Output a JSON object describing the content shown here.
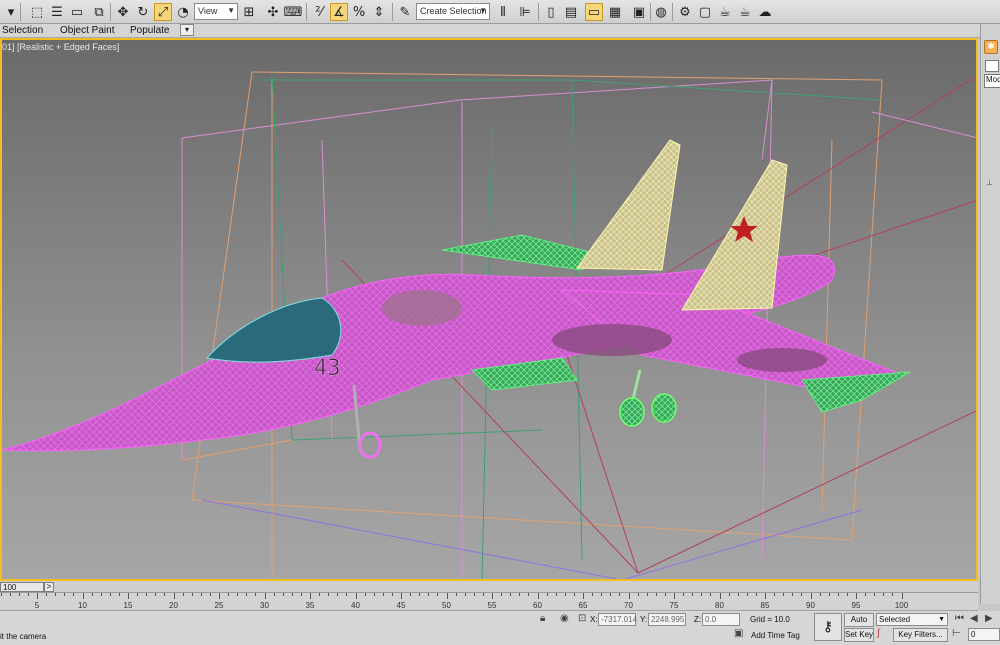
{
  "toolbar": {
    "view_dropdown": "View",
    "selection_set_placeholder": "Create Selection Se",
    "icons": [
      "undo-icon",
      "select-object-icon",
      "select-by-name-icon",
      "rectangular-region-icon",
      "window-crossing-icon",
      "select-move-icon",
      "select-rotate-icon",
      "select-scale-icon",
      "select-place-icon",
      "reference-coordinate-dropdown",
      "use-pivot-icon",
      "select-manipulate-icon",
      "keyboard-shortcut-icon",
      "snaps-toggle-icon",
      "angle-snap-icon",
      "percent-snap-icon",
      "spinner-snap-icon",
      "edit-named-selection-icon",
      "mirror-icon",
      "align-icon",
      "toggle-scene-explorer-icon",
      "toggle-layer-explorer-icon",
      "toggle-ribbon-icon",
      "curve-editor-icon",
      "schematic-view-icon",
      "material-editor-icon",
      "render-setup-icon",
      "rendered-frame-window-icon",
      "render-production-icon",
      "render-iterative-icon",
      "a360-cloud-icon"
    ]
  },
  "ribbon": {
    "items": [
      "Selection",
      "Object Paint",
      "Populate"
    ]
  },
  "viewport": {
    "label": "01] [Realistic + Edged Faces]",
    "model_marking": "43"
  },
  "command_panel": {
    "tab_label": "Modi"
  },
  "timeslider": {
    "position": "100",
    "next_label": ">"
  },
  "trackbar": {
    "ticks": [
      "5",
      "10",
      "15",
      "20",
      "25",
      "30",
      "35",
      "40",
      "45",
      "50",
      "55",
      "60",
      "65",
      "70",
      "75",
      "80",
      "85",
      "90",
      "95",
      "100"
    ]
  },
  "statusbar": {
    "prompt": "it the camera",
    "x_label": "X:",
    "x_value": "-7317.014",
    "y_label": "Y:",
    "y_value": "2248.995",
    "z_label": "Z:",
    "z_value": "0.0",
    "grid": "Grid = 10.0",
    "add_time_tag": "Add Time Tag",
    "auto_key": "Auto Key",
    "set_key": "Set Key",
    "selected_dropdown": "Selected",
    "key_filters": "Key Filters...",
    "frame_value": "0"
  },
  "colors": {
    "viewport_border": "#f0c020",
    "active_tool": "#f5d77a",
    "mesh_magenta": "#e040e0",
    "mesh_yellow": "#f0e8a0",
    "mesh_green": "#40ff60"
  }
}
